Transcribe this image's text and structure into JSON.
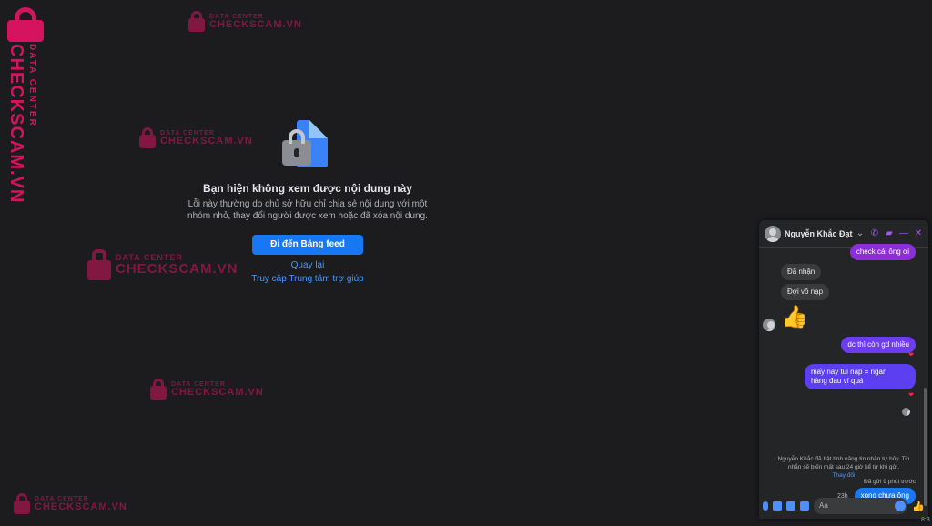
{
  "watermark": {
    "brand": "CHECKSCAM.VN",
    "tagline": "DATA CENTER"
  },
  "side_logo": {
    "brand": "CHECKSCAM.VN",
    "tagline": "DATA CENTER"
  },
  "unavailable": {
    "title": "Bạn hiện không xem được nội dung này",
    "description_line1": "Lỗi này thường do chủ sở hữu chỉ chia sẻ nội dung với một",
    "description_line2": "nhóm nhỏ, thay đổi người được xem hoặc đã xóa nội dung.",
    "feed_button": "Đi đến Bảng feed",
    "back_link": "Quay lại",
    "help_link": "Truy cập Trung tâm trợ giúp"
  },
  "chat": {
    "contact_name": "Nguyễn Khắc Đạt",
    "messages": {
      "out1": "check cái ông ơi",
      "in1": "Đã nhận",
      "in2": "Đợi vô nạp",
      "like": "👍",
      "out2": "dc thì còn gd nhiều",
      "out3_line1": "mấy nay tui nạp = ngân",
      "out3_line2": "hàng đau ví quá",
      "system_line1": "Nguyễn Khắc đã bật tính năng tin nhắn tự hủy. Tin",
      "system_line2": "nhắn sẽ biến mất sau 24 giờ kể từ khi gửi.",
      "system_change": "Thay đổi",
      "time": "23h",
      "out4": "xong chưa ông",
      "sent_status": "Đã gửi 9 phút trước"
    },
    "input_placeholder": "Aa"
  },
  "taskbar_time": "8:3"
}
